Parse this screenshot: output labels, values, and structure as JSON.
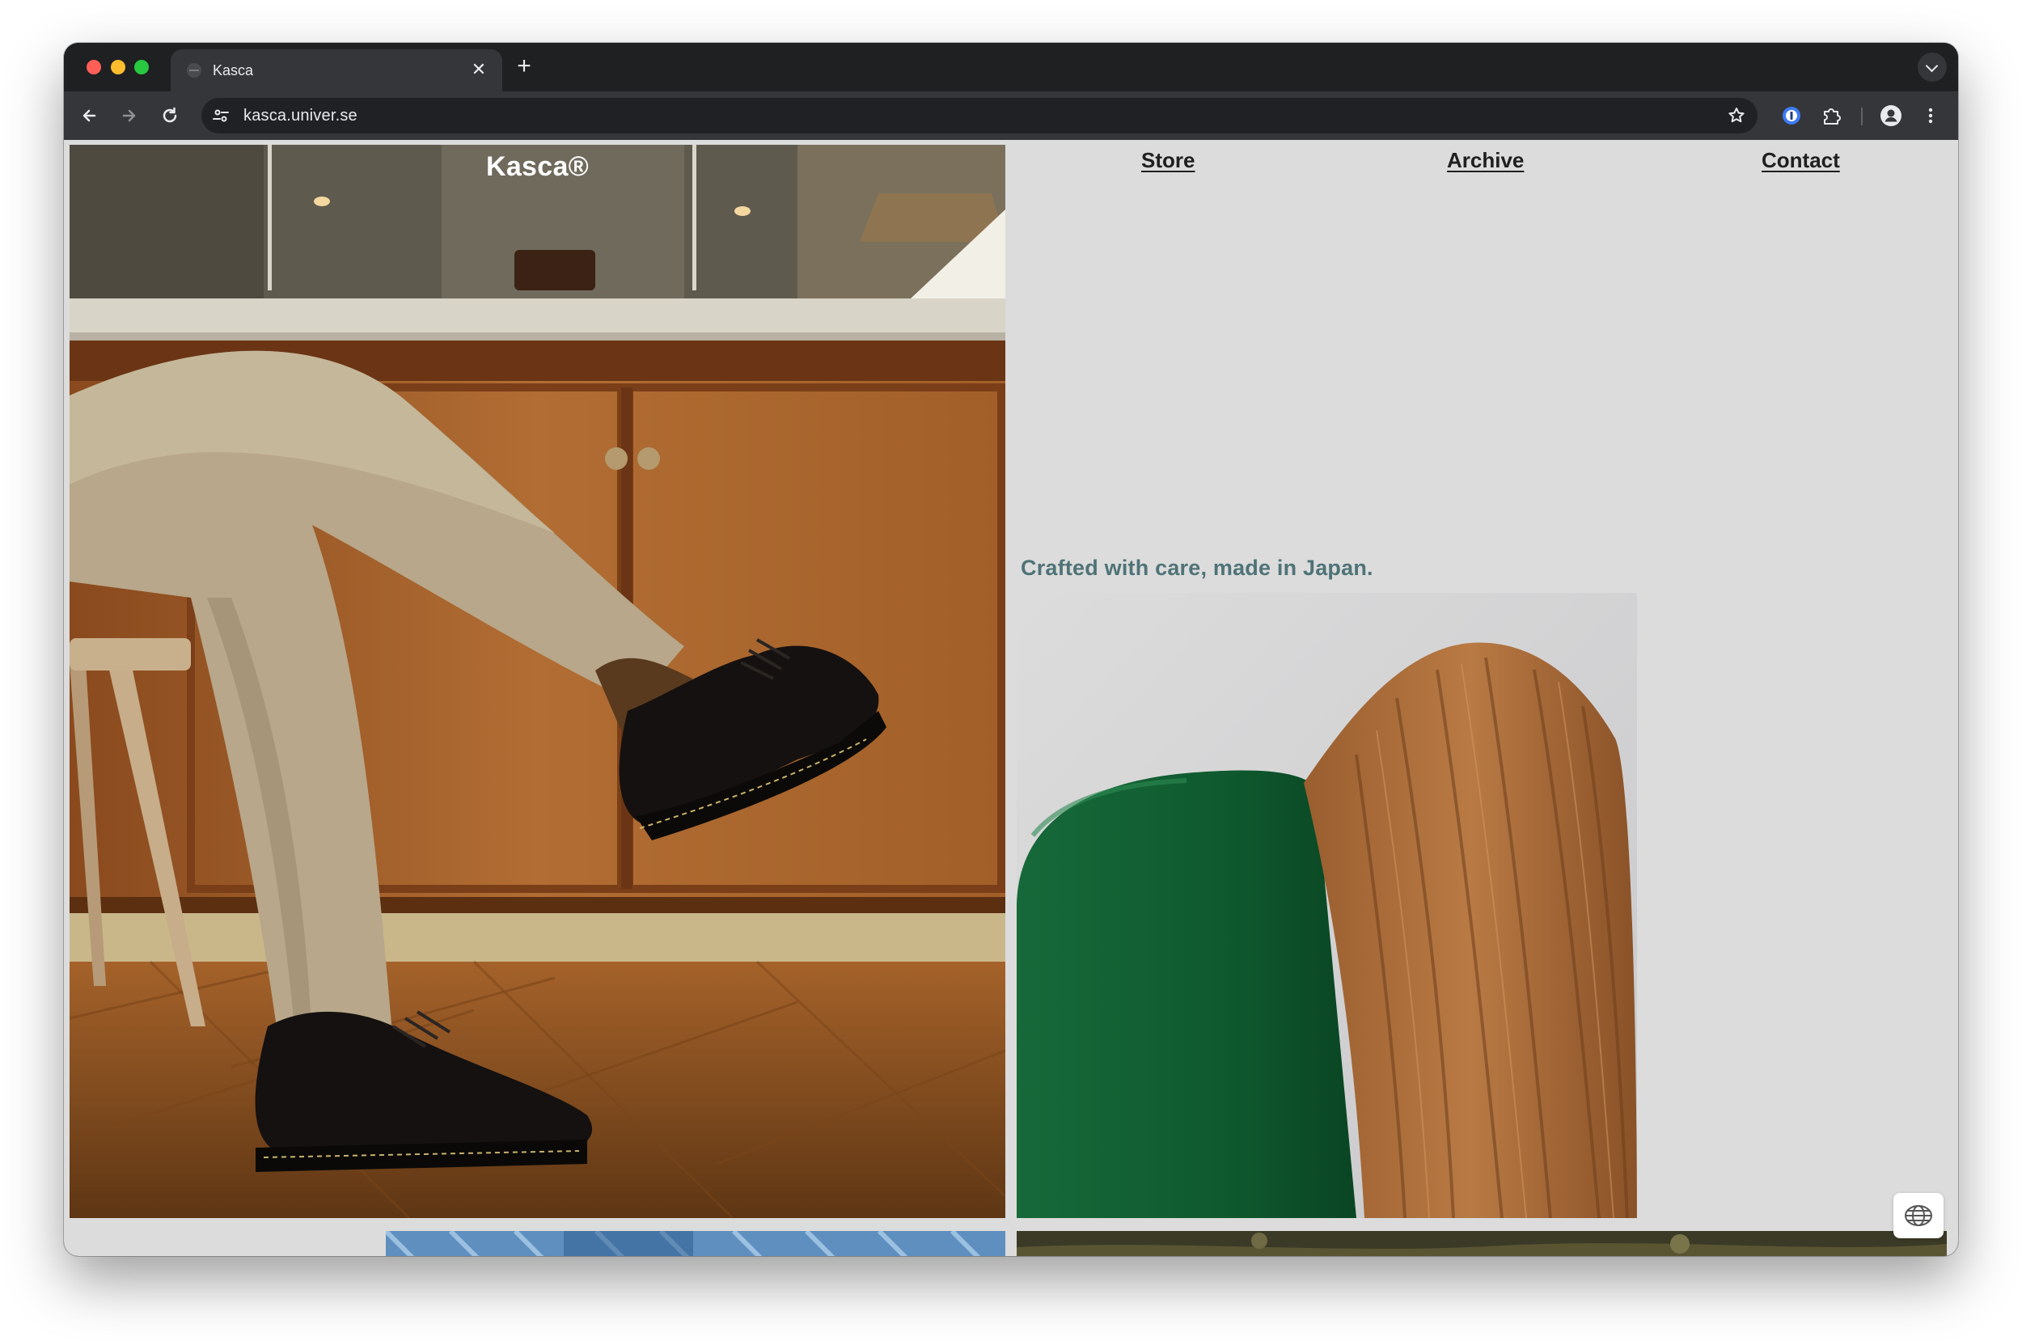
{
  "browser": {
    "tab": {
      "title": "Kasca",
      "close_icon": "close-icon",
      "favicon": "site-favicon"
    },
    "new_tab_icon": "plus-icon",
    "tab_search_icon": "chevron-down-icon",
    "toolbar": {
      "back_icon": "arrow-left-icon",
      "forward_icon": "arrow-right-icon",
      "reload_icon": "reload-icon",
      "site_info_icon": "tune-icon",
      "url": "kasca.univer.se",
      "bookmark_icon": "star-icon",
      "extensions": [
        "password-manager-icon",
        "puzzle-icon"
      ],
      "profile_icon": "person-icon",
      "menu_icon": "kebab-menu-icon"
    },
    "traffic_lights": {
      "close": "#ff5f57",
      "minimize": "#febc2e",
      "zoom": "#28c840"
    }
  },
  "page": {
    "brand": "Kasca®",
    "nav": {
      "store": "Store",
      "archive": "Archive",
      "contact": "Contact"
    },
    "tagline": "Crafted with care, made in Japan.",
    "language_icon": "globe-icon",
    "colors": {
      "background": "#dcdcdc",
      "tagline": "#4f7377",
      "nav_text": "#202020",
      "brand_text": "#ffffff"
    }
  }
}
